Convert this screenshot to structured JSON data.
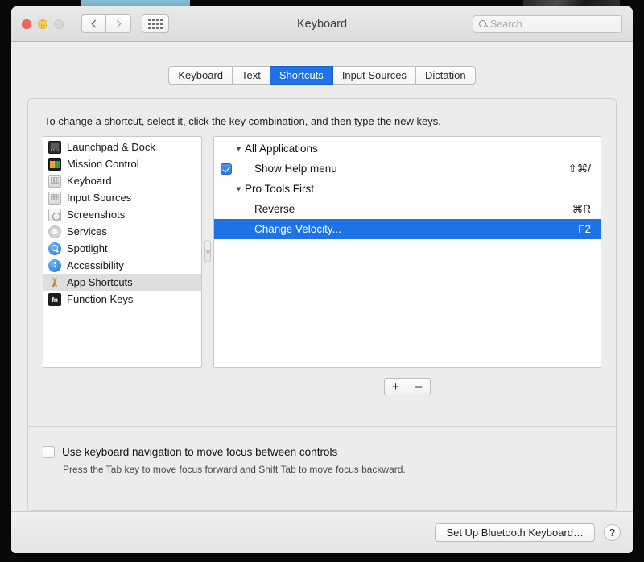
{
  "window": {
    "title": "Keyboard",
    "traffic_lights": [
      "close",
      "minimize",
      "zoom"
    ],
    "nav": {
      "back": "back-icon",
      "forward": "forward-icon",
      "grid": "show-all-icon"
    },
    "search": {
      "placeholder": "Search",
      "icon": "search-icon"
    }
  },
  "tabs": [
    {
      "label": "Keyboard",
      "active": false
    },
    {
      "label": "Text",
      "active": false
    },
    {
      "label": "Shortcuts",
      "active": true
    },
    {
      "label": "Input Sources",
      "active": false
    },
    {
      "label": "Dictation",
      "active": false
    }
  ],
  "instructions": "To change a shortcut, select it, click the key combination, and then type the new keys.",
  "categories": [
    {
      "label": "Launchpad & Dock",
      "icon": "launchpad-dock-icon",
      "selected": false
    },
    {
      "label": "Mission Control",
      "icon": "mission-control-icon",
      "selected": false
    },
    {
      "label": "Keyboard",
      "icon": "keyboard-icon",
      "selected": false
    },
    {
      "label": "Input Sources",
      "icon": "input-sources-icon",
      "selected": false
    },
    {
      "label": "Screenshots",
      "icon": "screenshots-icon",
      "selected": false
    },
    {
      "label": "Services",
      "icon": "services-gear-icon",
      "selected": false
    },
    {
      "label": "Spotlight",
      "icon": "spotlight-icon",
      "selected": false
    },
    {
      "label": "Accessibility",
      "icon": "accessibility-icon",
      "selected": false
    },
    {
      "label": "App Shortcuts",
      "icon": "app-shortcuts-icon",
      "selected": true
    },
    {
      "label": "Function Keys",
      "icon": "function-keys-icon",
      "selected": false
    }
  ],
  "shortcuts": [
    {
      "type": "group",
      "label": "All Applications",
      "expanded": true,
      "key": "",
      "checked": null,
      "selected": false
    },
    {
      "type": "item",
      "label": "Show Help menu",
      "expanded": false,
      "key": "⇧⌘/",
      "checked": true,
      "selected": false
    },
    {
      "type": "group",
      "label": "Pro Tools First",
      "expanded": true,
      "key": "",
      "checked": null,
      "selected": false
    },
    {
      "type": "item",
      "label": "Reverse",
      "expanded": false,
      "key": "⌘R",
      "checked": false,
      "selected": false
    },
    {
      "type": "item",
      "label": "Change Velocity...",
      "expanded": false,
      "key": "F2",
      "checked": false,
      "selected": true
    }
  ],
  "list_buttons": {
    "add": "+",
    "remove": "–"
  },
  "keyboard_navigation": {
    "checked": false,
    "label": "Use keyboard navigation to move focus between controls",
    "description": "Press the Tab key to move focus forward and Shift Tab to move focus backward."
  },
  "footer": {
    "bluetooth_button": "Set Up Bluetooth Keyboard…",
    "help_button": "?"
  },
  "colors": {
    "accent": "#1e72e8",
    "window_bg": "#ececec",
    "selected_sidebar": "#dedede"
  }
}
